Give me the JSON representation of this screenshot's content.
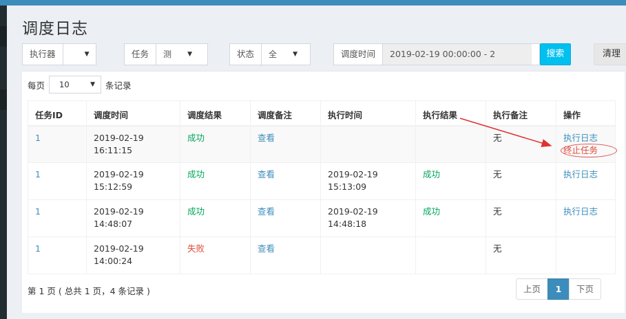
{
  "page_title": "调度日志",
  "filters": {
    "executor": {
      "label": "执行器",
      "value": ""
    },
    "task": {
      "label": "任务",
      "value": "测"
    },
    "status": {
      "label": "状态",
      "value": "全"
    },
    "time": {
      "label": "调度时间",
      "value": "2019-02-19 00:00:00 - 2"
    },
    "search_label": "搜索",
    "clear_label": "清理"
  },
  "perpage": {
    "prefix": "每页",
    "value": "10",
    "suffix": "条记录"
  },
  "table": {
    "headers": [
      "任务ID",
      "调度时间",
      "调度结果",
      "调度备注",
      "执行时间",
      "执行结果",
      "执行备注",
      "操作"
    ],
    "rows": [
      {
        "id": "1",
        "trigger_date": "2019-02-19",
        "trigger_time": "16:11:15",
        "trigger_result": "成功",
        "trigger_note": "查看",
        "exec_date": "",
        "exec_time": "",
        "exec_result": "",
        "exec_note": "无",
        "op1": "执行日志",
        "op2": "终止任务"
      },
      {
        "id": "1",
        "trigger_date": "2019-02-19",
        "trigger_time": "15:12:59",
        "trigger_result": "成功",
        "trigger_note": "查看",
        "exec_date": "2019-02-19",
        "exec_time": "15:13:09",
        "exec_result": "成功",
        "exec_note": "无",
        "op1": "执行日志",
        "op2": ""
      },
      {
        "id": "1",
        "trigger_date": "2019-02-19",
        "trigger_time": "14:48:07",
        "trigger_result": "成功",
        "trigger_note": "查看",
        "exec_date": "2019-02-19",
        "exec_time": "14:48:18",
        "exec_result": "成功",
        "exec_note": "无",
        "op1": "执行日志",
        "op2": ""
      },
      {
        "id": "1",
        "trigger_date": "2019-02-19",
        "trigger_time": "14:00:24",
        "trigger_result": "失败",
        "trigger_note": "查看",
        "exec_date": "",
        "exec_time": "",
        "exec_result": "",
        "exec_note": "无",
        "op1": "",
        "op2": ""
      }
    ]
  },
  "footer": {
    "info": "第 1 页 ( 总共 1 页，4 条记录 )"
  },
  "pager": {
    "prev": "上页",
    "current": "1",
    "next": "下页"
  },
  "colors": {
    "accent": "#3c8dbc",
    "success": "#00a65a",
    "danger": "#dd4b39",
    "search": "#00c0ef"
  }
}
